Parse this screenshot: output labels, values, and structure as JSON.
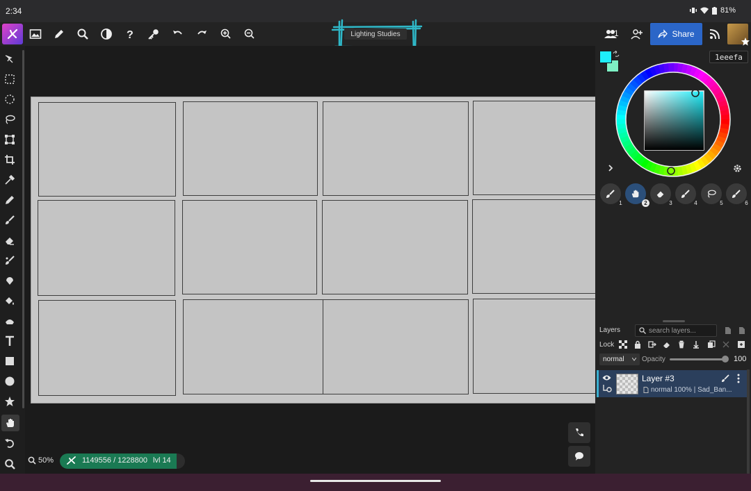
{
  "status_bar": {
    "time": "2:34",
    "battery": "81%"
  },
  "toolbar": {
    "document_name": "Lighting Studies",
    "users_count": "1",
    "share_label": "Share"
  },
  "color": {
    "hex": "1eeefa",
    "primary": "#1eeefa",
    "secondary": "#7ef0c4"
  },
  "brushes": [
    {
      "num": "1"
    },
    {
      "num": "2"
    },
    {
      "num": "3"
    },
    {
      "num": "4"
    },
    {
      "num": "5"
    },
    {
      "num": "6"
    }
  ],
  "layers": {
    "title": "Layers",
    "search_placeholder": "search layers...",
    "lock_label": "Lock",
    "blend_mode": "normal",
    "opacity_label": "Opacity",
    "opacity_value": "100",
    "opacity_fraction": 1.0,
    "items": [
      {
        "name": "Layer #3",
        "meta": "normal 100% | Sad_Ban..."
      }
    ]
  },
  "footer": {
    "zoom": "50%",
    "xp_text": "1149556 / 1228800",
    "level": "lvl 14",
    "xp_progress": 0.9355
  }
}
